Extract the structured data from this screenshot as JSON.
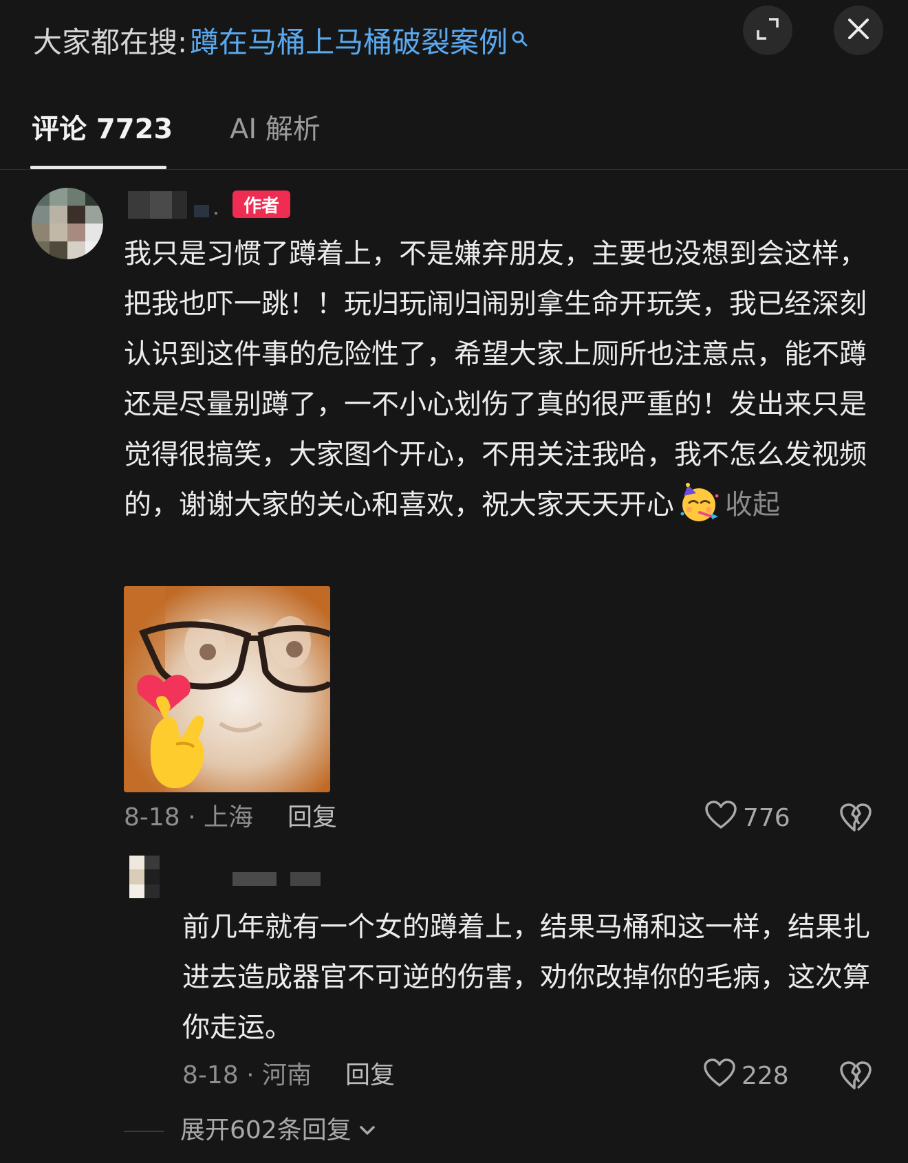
{
  "search": {
    "prefix": "大家都在搜:",
    "query": "蹲在马桶上马桶破裂案例",
    "search_icon": "search-icon",
    "expand_icon": "expand-icon",
    "close_icon": "close-icon"
  },
  "tabs": [
    {
      "label": "评论 7723",
      "active": true
    },
    {
      "label": "AI 解析",
      "active": false
    }
  ],
  "comments": [
    {
      "author_badge": "作者",
      "text": "我只是习惯了蹲着上，不是嫌弃朋友，主要也没想到会这样，把我也吓一跳！！玩归玩闹归闹别拿生命开玩笑，我已经深刻认识到这件事的危险性了，希望大家上厕所也注意点，能不蹲还是尽量别蹲了，一不小心划伤了真的很严重的！发出来只是觉得很搞笑，大家图个开心，不用关注我哈，我不怎么发视频的，谢谢大家的关心和喜欢，祝大家天天开心",
      "emoji": "partying-face-emoji",
      "collapse_label": "收起",
      "sticker": "cat-glasses-finger-heart-sticker",
      "date_location": "8-18 · 上海",
      "reply_label": "回复",
      "likes": "776",
      "like_icon": "heart-icon",
      "dislike_icon": "broken-heart-icon"
    },
    {
      "text": "前几年就有一个女的蹲着上，结果马桶和这一样，结果扎进去造成器官不可逆的伤害，劝你改掉你的毛病，这次算你走运。",
      "date_location": "8-18 · 河南",
      "reply_label": "回复",
      "likes": "228",
      "like_icon": "heart-icon",
      "dislike_icon": "broken-heart-icon"
    }
  ],
  "expand_replies": {
    "label": "展开602条回复",
    "icon": "chevron-down-icon"
  }
}
